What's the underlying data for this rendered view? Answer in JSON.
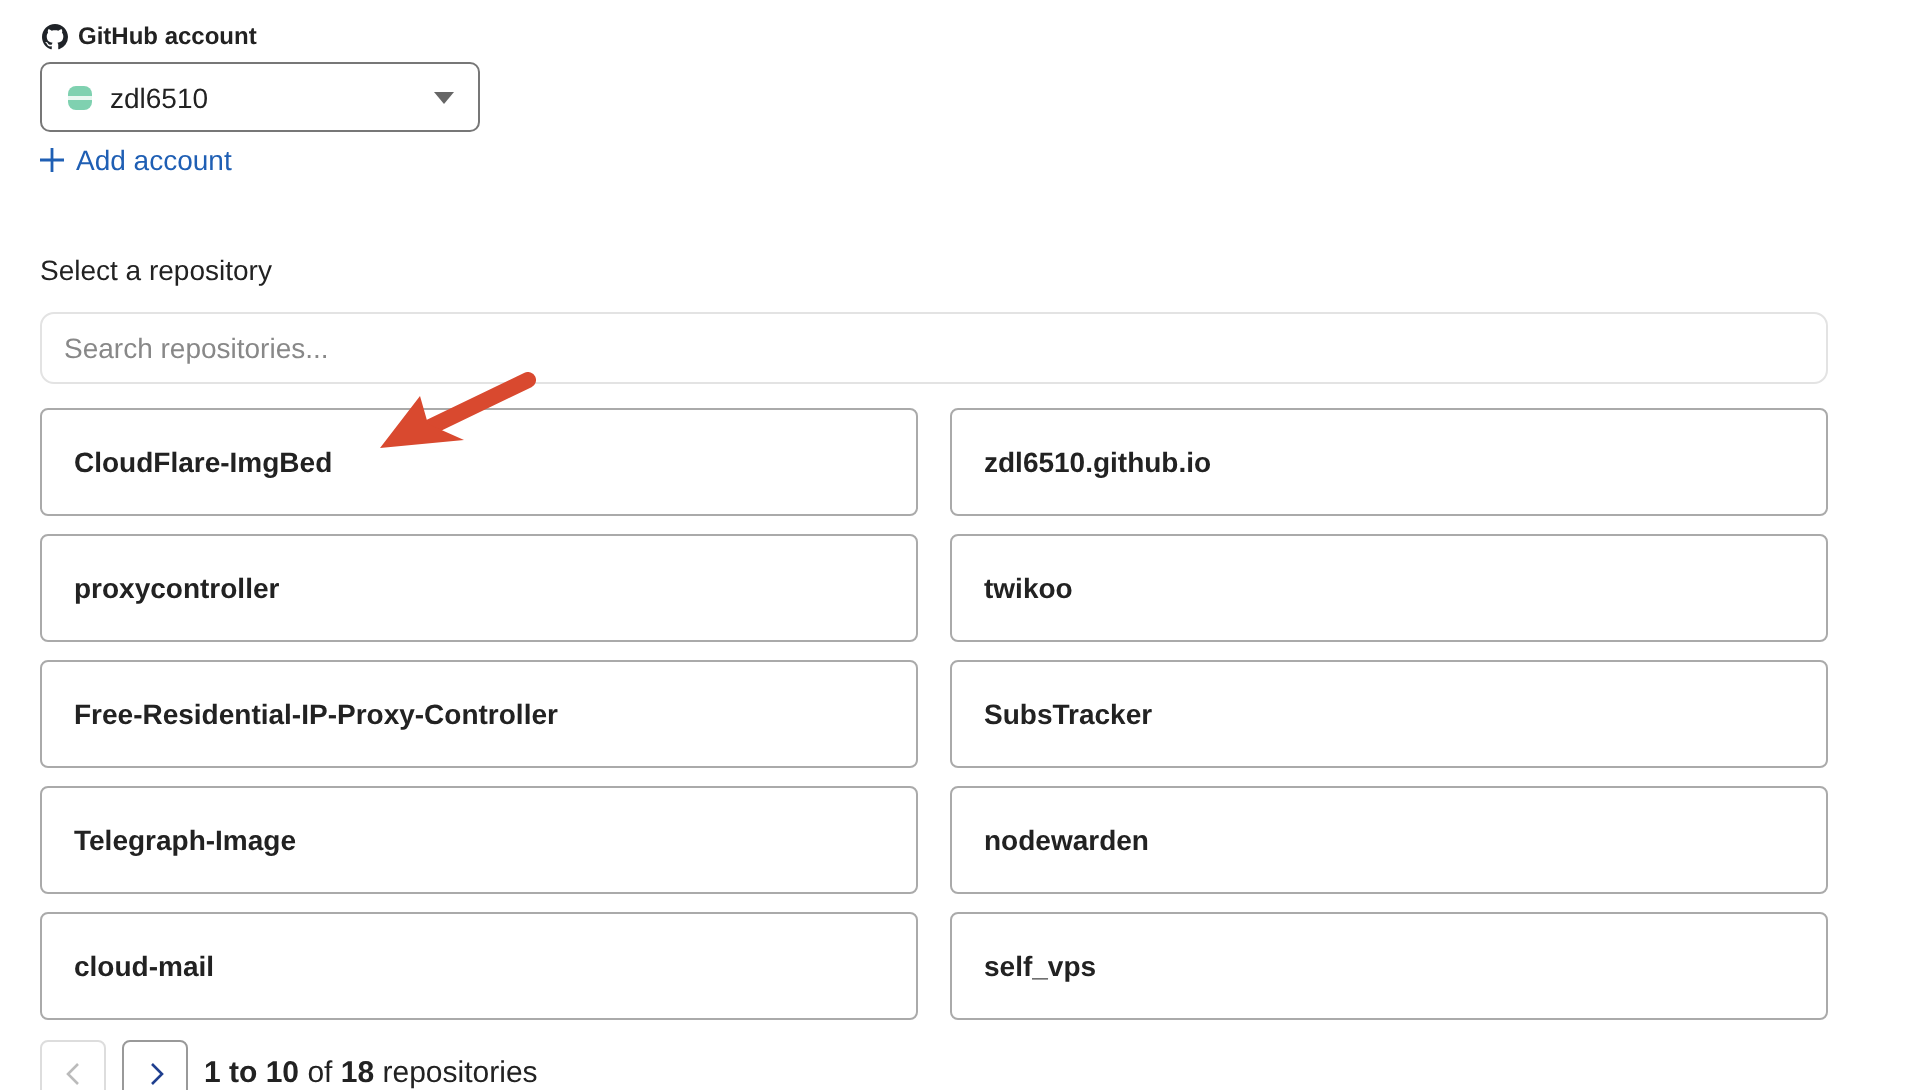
{
  "account": {
    "label": "GitHub account",
    "selected_account": "zdl6510",
    "add_link": "Add account"
  },
  "repository": {
    "label": "Select a repository",
    "search": {
      "placeholder": "Search repositories..."
    },
    "items": [
      {
        "name": "CloudFlare-ImgBed"
      },
      {
        "name": "zdl6510.github.io"
      },
      {
        "name": "proxycontroller"
      },
      {
        "name": "twikoo"
      },
      {
        "name": "Free-Residential-IP-Proxy-Controller"
      },
      {
        "name": "SubsTracker"
      },
      {
        "name": "Telegraph-Image"
      },
      {
        "name": "nodewarden"
      },
      {
        "name": "cloud-mail"
      },
      {
        "name": "self_vps"
      }
    ],
    "pagination": {
      "previous_disabled": true,
      "next_disabled": false,
      "summary": "**1 to 10** of **18** repositories"
    }
  }
}
